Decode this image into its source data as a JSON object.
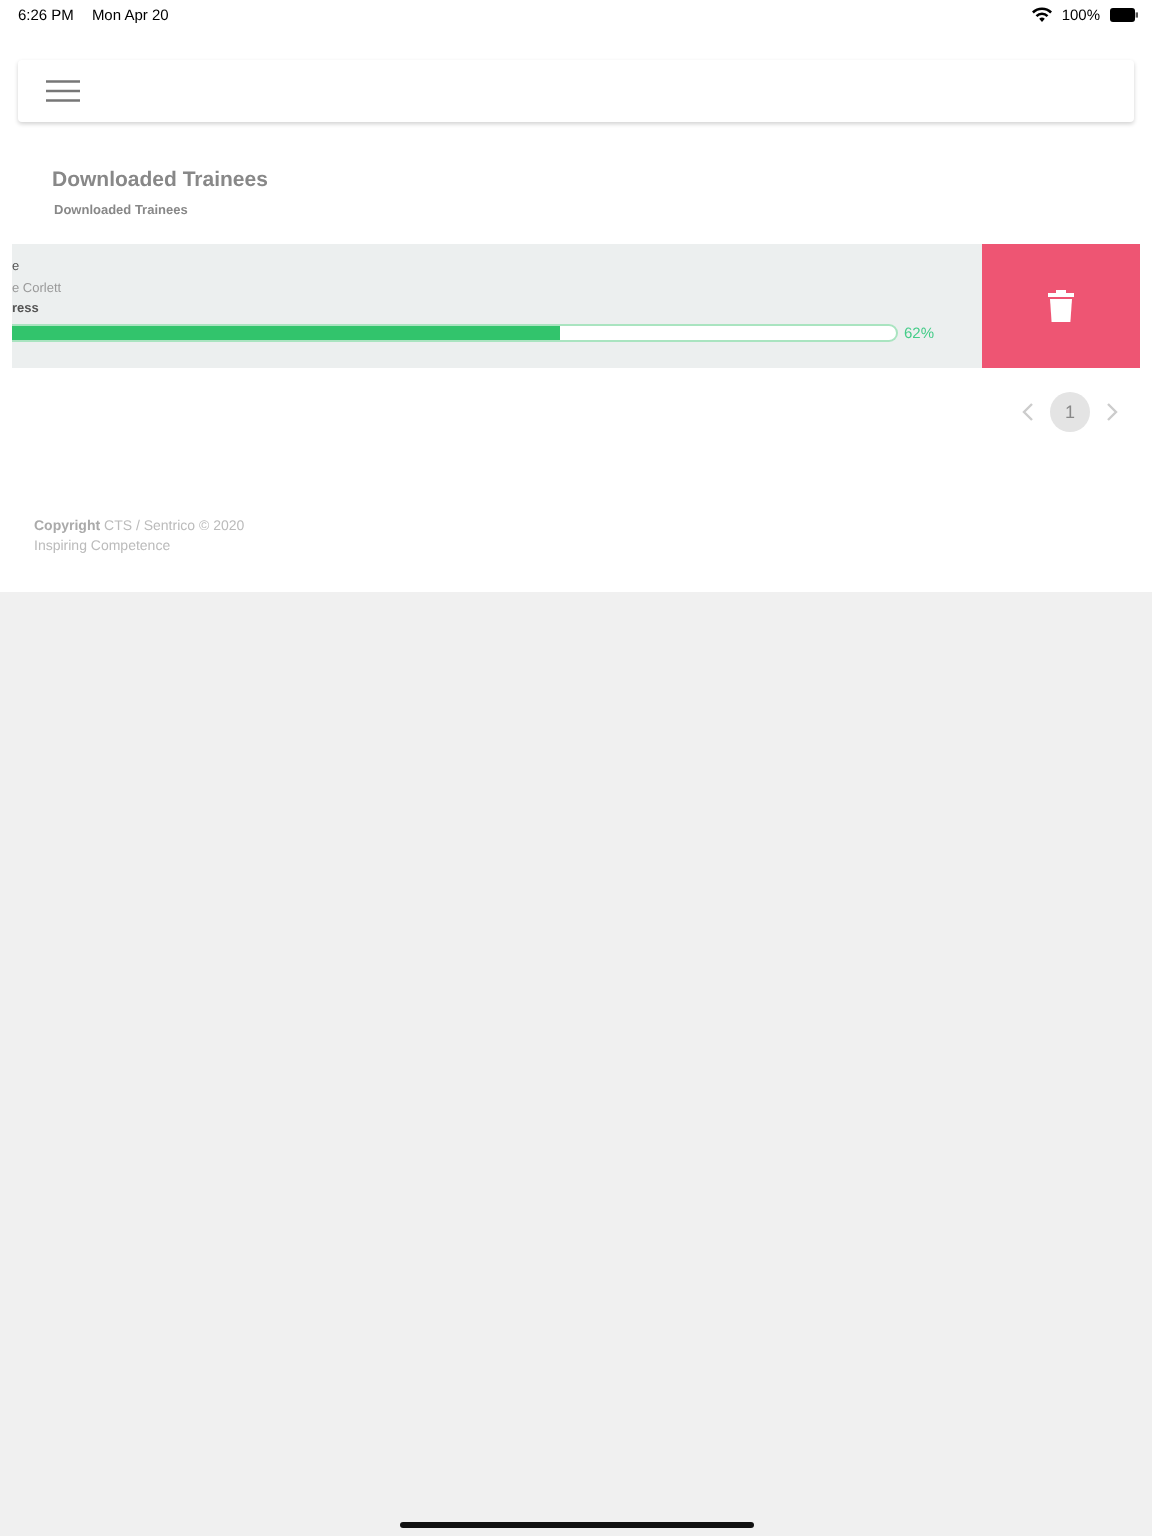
{
  "status_bar": {
    "time": "6:26 PM",
    "date": "Mon Apr 20",
    "battery": "100%"
  },
  "page": {
    "title": "Downloaded Trainees",
    "breadcrumb": "Downloaded Trainees"
  },
  "trainees": [
    {
      "line_1": "e",
      "line_2": "e Corlett",
      "line_3": "ress",
      "level": 0.62,
      "reading": "62%"
    }
  ],
  "pagination": {
    "pages": [
      {
        "label": "1",
        "selected": true
      }
    ]
  },
  "footer": {
    "copyright": "**Copyright** CTS / Sentrico © 2020",
    "tagline": "Inspiring Competence"
  }
}
